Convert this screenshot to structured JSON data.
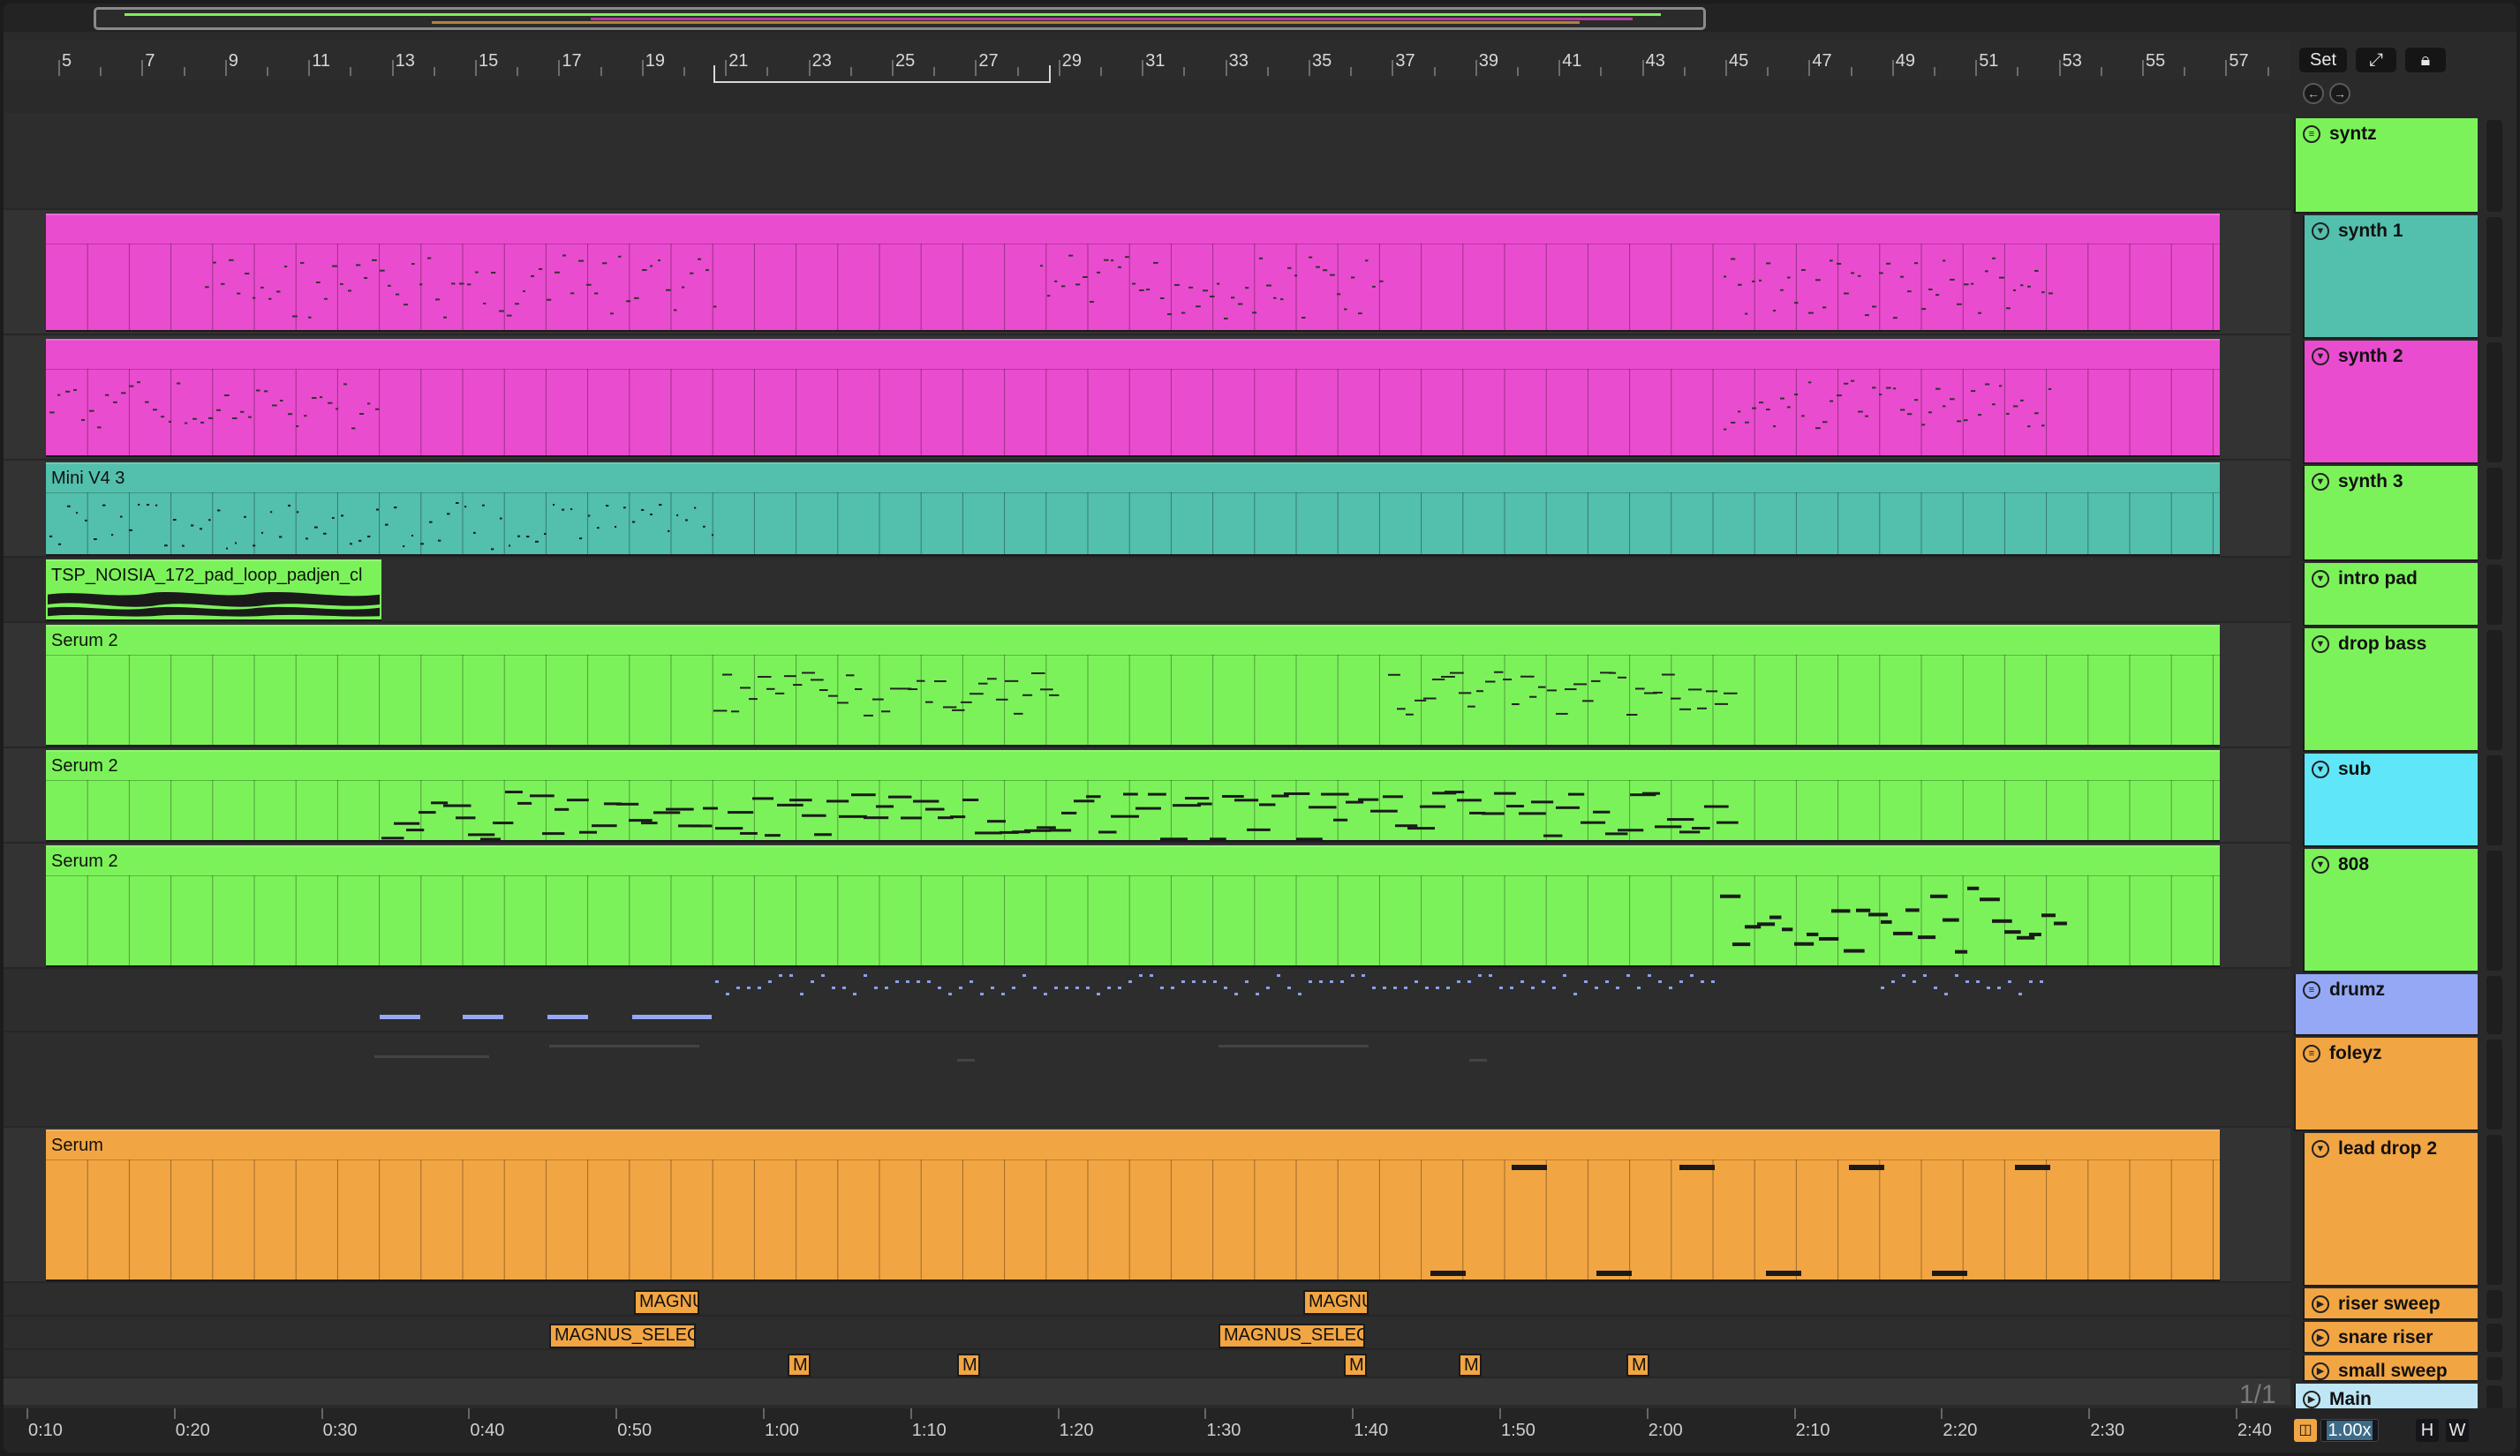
{
  "ruler": {
    "bars": [
      "5",
      "7",
      "9",
      "11",
      "13",
      "15",
      "17",
      "19",
      "21",
      "23",
      "25",
      "27",
      "29",
      "31",
      "33",
      "35",
      "37",
      "39",
      "41",
      "43",
      "45",
      "47",
      "49",
      "51",
      "53",
      "55",
      "57"
    ]
  },
  "header_buttons": {
    "set_label": "Set",
    "expand_icon": "expand-icon",
    "lock_icon": "lock-icon"
  },
  "tracks": [
    {
      "id": "syntz",
      "name": "syntz",
      "kind": "group",
      "color": "#7cf25a"
    },
    {
      "id": "synth-1",
      "name": "synth 1",
      "kind": "track",
      "color": "#53bfad"
    },
    {
      "id": "synth-2",
      "name": "synth 2",
      "kind": "track",
      "color": "#ea4ccf"
    },
    {
      "id": "synth-3",
      "name": "synth 3",
      "kind": "track",
      "color": "#7cf25a"
    },
    {
      "id": "intro-pad",
      "name": "intro pad",
      "kind": "track",
      "color": "#7cf25a"
    },
    {
      "id": "drop-bass",
      "name": "drop bass",
      "kind": "track",
      "color": "#7cf25a"
    },
    {
      "id": "sub",
      "name": "sub",
      "kind": "track",
      "color": "#5fe6f8"
    },
    {
      "id": "808",
      "name": "808",
      "kind": "track",
      "color": "#7cf25a"
    },
    {
      "id": "drumz",
      "name": "drumz",
      "kind": "group",
      "color": "#94a8f6"
    },
    {
      "id": "foleyz",
      "name": "foleyz",
      "kind": "group",
      "color": "#f2a543"
    },
    {
      "id": "lead-drop-2",
      "name": "lead drop 2",
      "kind": "track",
      "color": "#f2a543"
    },
    {
      "id": "riser-sweep",
      "name": "riser sweep",
      "kind": "track",
      "color": "#f2a543"
    },
    {
      "id": "snare-riser",
      "name": "snare riser",
      "kind": "track",
      "color": "#f2a543"
    },
    {
      "id": "small-sweep",
      "name": "small sweep",
      "kind": "track",
      "color": "#f2a543"
    },
    {
      "id": "main",
      "name": "Main",
      "kind": "main",
      "color": "#bfe6f5"
    }
  ],
  "clips": {
    "mini_v4": "Mini V4 3",
    "pad_loop": "TSP_NOISIA_172_pad_loop_padjen_cl",
    "serum2_a": "Serum 2",
    "serum2_b": "Serum 2",
    "serum2_c": "Serum 2",
    "serum": "Serum",
    "magnus_1": "MAGNU",
    "magnus_2": "MAGNU",
    "magnus_select_1": "MAGNUS_SELEC",
    "magnus_select_2": "MAGNUS_SELEC",
    "m_label": "M"
  },
  "colors": {
    "pink": "#ea4ccf",
    "teal": "#53bfad",
    "green": "#7cf25a",
    "orange": "#f2a543",
    "cyan": "#5fe6f8",
    "lavender": "#94a8f6",
    "main_blue": "#bfe6f5"
  },
  "time_ruler": {
    "labels": [
      "0:10",
      "0:20",
      "0:30",
      "0:40",
      "0:50",
      "1:00",
      "1:10",
      "1:20",
      "1:30",
      "1:40",
      "1:50",
      "2:00",
      "2:10",
      "2:20",
      "2:30",
      "2:40"
    ]
  },
  "page_indicator": "1/1",
  "bottom": {
    "zoom": "1.00x",
    "h_label": "H",
    "w_label": "W"
  }
}
